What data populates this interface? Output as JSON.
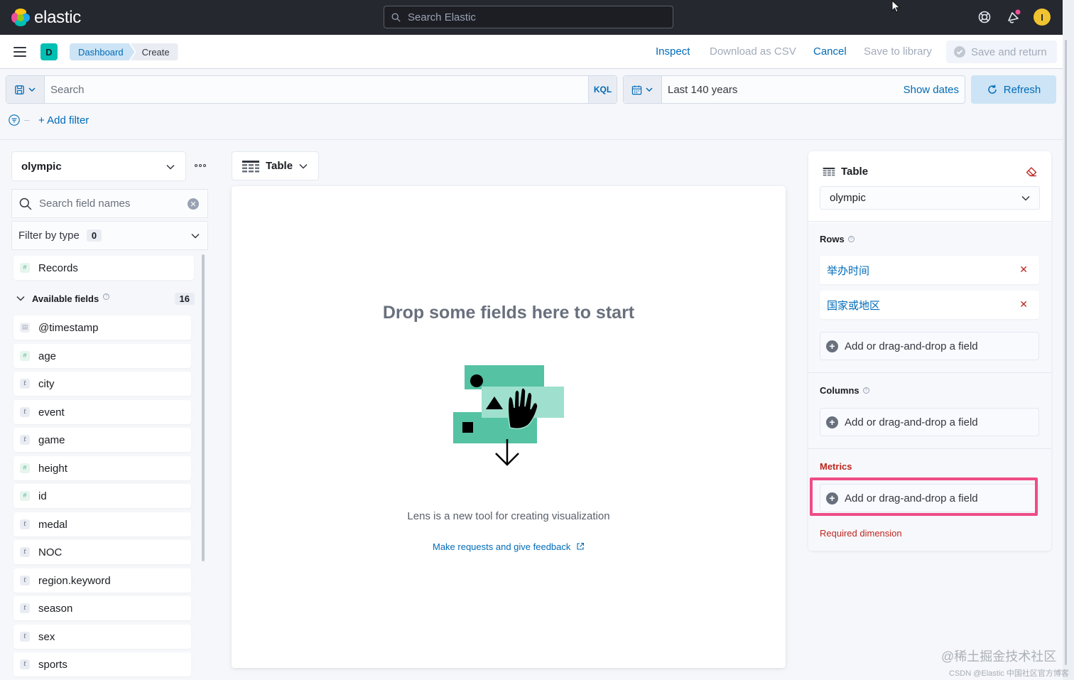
{
  "header": {
    "brand": "elastic",
    "search_placeholder": "Search Elastic",
    "avatar_initial": "I"
  },
  "nav": {
    "space_initial": "D",
    "breadcrumbs": [
      "Dashboard",
      "Create"
    ],
    "actions": {
      "inspect": "Inspect",
      "download_csv": "Download as CSV",
      "cancel": "Cancel",
      "save_library": "Save to library",
      "save_return": "Save and return"
    }
  },
  "query": {
    "placeholder": "Search",
    "language": "KQL",
    "time_range": "Last 140 years",
    "show_dates": "Show dates",
    "refresh": "Refresh",
    "add_filter": "+ Add filter"
  },
  "datapanel": {
    "index_pattern": "olympic",
    "field_search_placeholder": "Search field names",
    "filter_by_type": "Filter by type",
    "filter_count": "0",
    "records": "Records",
    "available_label": "Available fields",
    "available_count": "16",
    "fields": [
      {
        "name": "@timestamp",
        "type": "date"
      },
      {
        "name": "age",
        "type": "number"
      },
      {
        "name": "city",
        "type": "string"
      },
      {
        "name": "event",
        "type": "string"
      },
      {
        "name": "game",
        "type": "string"
      },
      {
        "name": "height",
        "type": "number"
      },
      {
        "name": "id",
        "type": "number"
      },
      {
        "name": "medal",
        "type": "string"
      },
      {
        "name": "NOC",
        "type": "string"
      },
      {
        "name": "region.keyword",
        "type": "string"
      },
      {
        "name": "season",
        "type": "string"
      },
      {
        "name": "sex",
        "type": "string"
      },
      {
        "name": "sports",
        "type": "string"
      }
    ]
  },
  "workspace": {
    "vis_type": "Table",
    "title": "Drop some fields here to start",
    "subtitle": "Lens is a new tool for creating visualization",
    "feedback_link": "Make requests and give feedback"
  },
  "config": {
    "title": "Table",
    "layer_index": "olympic",
    "rows_label": "Rows",
    "rows": [
      "举办时间",
      "国家或地区"
    ],
    "columns_label": "Columns",
    "metrics_label": "Metrics",
    "add_field": "Add or drag-and-drop a field",
    "required": "Required dimension"
  },
  "colors": {
    "accent": "#006bb8",
    "danger": "#bd271e",
    "highlight": "#ee4c85",
    "header_bg": "#25282f"
  },
  "watermark": {
    "line1": "@稀土掘金技术社区",
    "line2": "CSDN @Elastic 中国社区官方博客"
  }
}
